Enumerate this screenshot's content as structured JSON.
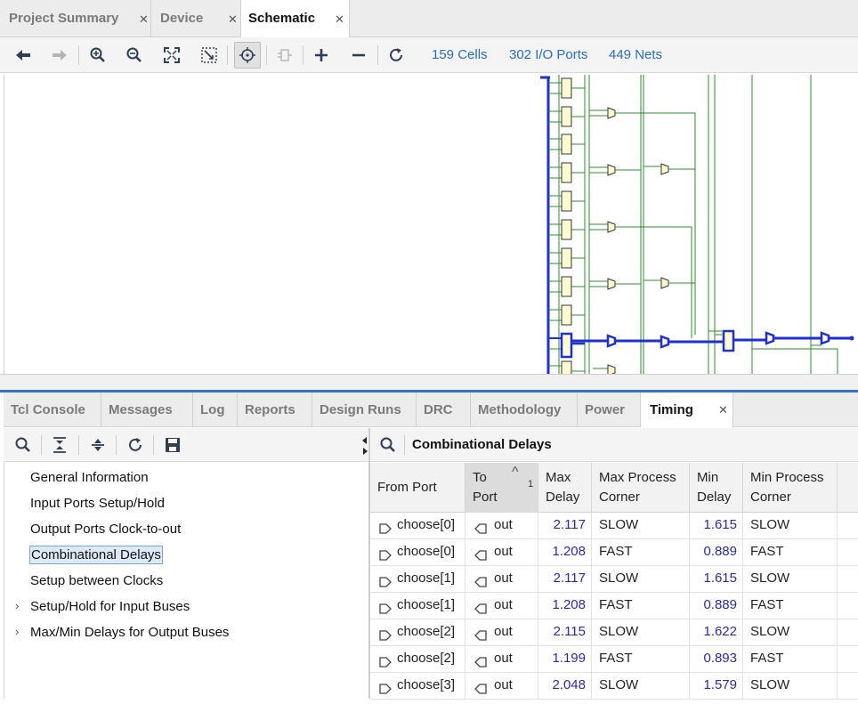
{
  "top_tabs": [
    {
      "label": "Project Summary"
    },
    {
      "label": "Device"
    },
    {
      "label": "Schematic"
    }
  ],
  "toolbar_stats": {
    "cells": "159 Cells",
    "io_ports": "302 I/O Ports",
    "nets": "449 Nets"
  },
  "bottom_tabs": [
    {
      "label": "Tcl Console"
    },
    {
      "label": "Messages"
    },
    {
      "label": "Log"
    },
    {
      "label": "Reports"
    },
    {
      "label": "Design Runs"
    },
    {
      "label": "DRC"
    },
    {
      "label": "Methodology"
    },
    {
      "label": "Power"
    },
    {
      "label": "Timing"
    }
  ],
  "tree": [
    {
      "label": "General Information"
    },
    {
      "label": "Input Ports Setup/Hold"
    },
    {
      "label": "Output Ports Clock-to-out"
    },
    {
      "label": "Combinational Delays"
    },
    {
      "label": "Setup between Clocks"
    },
    {
      "label": "Setup/Hold for Input Buses"
    },
    {
      "label": "Max/Min Delays for Output Buses"
    }
  ],
  "panel_title": "Combinational Delays",
  "columns": {
    "from_port": "From Port",
    "to_port_1": "To",
    "to_port_2": "Port",
    "sort_index": "1",
    "max_delay_1": "Max",
    "max_delay_2": "Delay",
    "max_corner_1": "Max Process",
    "max_corner_2": "Corner",
    "min_delay_1": "Min",
    "min_delay_2": "Delay",
    "min_corner_1": "Min Process",
    "min_corner_2": "Corner"
  },
  "rows": [
    {
      "from": "choose[0]",
      "to": "out",
      "max": "2.117",
      "maxc": "SLOW",
      "min": "1.615",
      "minc": "SLOW"
    },
    {
      "from": "choose[0]",
      "to": "out",
      "max": "1.208",
      "maxc": "FAST",
      "min": "0.889",
      "minc": "FAST"
    },
    {
      "from": "choose[1]",
      "to": "out",
      "max": "2.117",
      "maxc": "SLOW",
      "min": "1.615",
      "minc": "SLOW"
    },
    {
      "from": "choose[1]",
      "to": "out",
      "max": "1.208",
      "maxc": "FAST",
      "min": "0.889",
      "minc": "FAST"
    },
    {
      "from": "choose[2]",
      "to": "out",
      "max": "2.115",
      "maxc": "SLOW",
      "min": "1.622",
      "minc": "SLOW"
    },
    {
      "from": "choose[2]",
      "to": "out",
      "max": "1.199",
      "maxc": "FAST",
      "min": "0.893",
      "minc": "FAST"
    },
    {
      "from": "choose[3]",
      "to": "out",
      "max": "2.048",
      "maxc": "SLOW",
      "min": "1.579",
      "minc": "SLOW"
    }
  ],
  "colors": {
    "accent": "#3b73c4",
    "link": "#2a6ebb",
    "net_green": "#2e8b2e",
    "net_blue": "#1f2fd0",
    "cell_fill": "#fffbd0"
  }
}
